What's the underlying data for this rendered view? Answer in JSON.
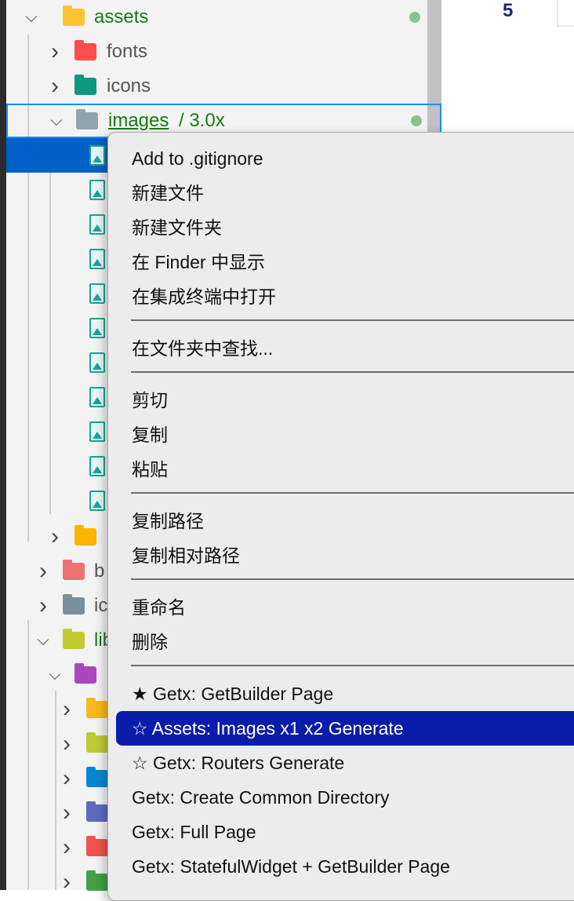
{
  "editor": {
    "line_number": "5"
  },
  "tree": [
    {
      "label": "assets",
      "icon": "folder-assets-icon",
      "color": "#ffc233",
      "state": "open",
      "green": true,
      "dot": true
    },
    {
      "label": "fonts",
      "icon": "folder-fonts-icon",
      "color": "#ff4c4c",
      "state": "closed"
    },
    {
      "label": "icons",
      "icon": "folder-icons-icon",
      "color": "#11967f",
      "state": "closed"
    },
    {
      "label": "images",
      "suffix": "/ 3.0x",
      "icon": "folder-open-icon",
      "color": "#90a4ae",
      "state": "open",
      "green": true,
      "dot": true
    },
    {
      "label": "",
      "icon": "folder-config-icon",
      "color": "#ffb300",
      "state": "closed"
    },
    {
      "label": "b",
      "icon": "folder-bag-icon",
      "color": "#ec7373",
      "state": "closed"
    },
    {
      "label": "ic",
      "icon": "folder-ios-icon",
      "color": "#78909c",
      "state": "closed"
    },
    {
      "label": "lib",
      "icon": "folder-lib-icon",
      "color": "#c0ca33",
      "state": "open",
      "green": true
    },
    {
      "label": "",
      "icon": "folder-purple-icon",
      "color": "#ab47bc",
      "state": "open"
    },
    {
      "label": "",
      "icon": "folder-yellow-icon",
      "color": "#f9b81c",
      "state": "closed"
    },
    {
      "label": "",
      "icon": "folder-lime-icon",
      "color": "#c0ca33",
      "state": "closed"
    },
    {
      "label": "",
      "icon": "folder-blue-icon",
      "color": "#0288d1",
      "state": "closed"
    },
    {
      "label": "",
      "icon": "folder-i18n-icon",
      "color": "#5c6bc0",
      "state": "closed"
    },
    {
      "label": "",
      "icon": "folder-red-icon",
      "color": "#ef5350",
      "state": "closed"
    },
    {
      "label": "",
      "icon": "folder-green-icon",
      "color": "#43a047",
      "state": "closed"
    }
  ],
  "image_file_count": 11,
  "context_menu": {
    "groups": [
      [
        "Add to .gitignore",
        "新建文件",
        "新建文件夹",
        "在 Finder 中显示",
        "在集成终端中打开"
      ],
      [
        "在文件夹中查找..."
      ],
      [
        "剪切",
        "复制",
        "粘贴"
      ],
      [
        "复制路径",
        "复制相对路径"
      ],
      [
        "重命名",
        "删除"
      ],
      [
        "★ Getx: GetBuilder Page",
        "☆ Assets: Images x1 x2 Generate",
        "☆ Getx: Routers Generate",
        "Getx: Create Common Directory",
        "Getx: Full Page",
        "Getx: StatefulWidget + GetBuilder Page"
      ]
    ],
    "highlighted": "☆ Assets: Images x1 x2 Generate",
    "highlight_color": "#0a1ca8"
  },
  "colors": {
    "selection": "#0060c9",
    "git_modified": "#177a17"
  }
}
